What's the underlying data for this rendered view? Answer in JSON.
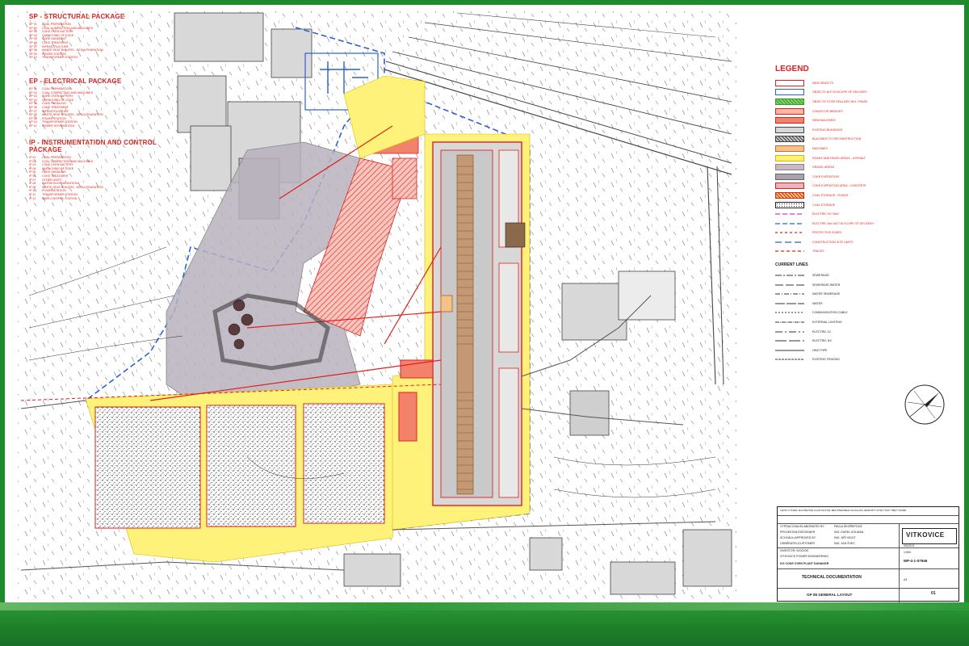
{
  "packages": [
    {
      "title": "SP - STRUCTURAL PACKAGE",
      "items": [
        {
          "code": "SP 01",
          "text": "COAL PREPARATION"
        },
        {
          "code": "SP 02",
          "text": "COAL COMPACTING AND MACHINES"
        },
        {
          "code": "SP 03",
          "text": "COKE OVEN BATTERY"
        },
        {
          "code": "SP 04",
          "text": "QUENCHING OF COKE"
        },
        {
          "code": "SP 05",
          "text": "COKE HANDLING"
        },
        {
          "code": "SP 06",
          "text": "COKE TREATMENT"
        },
        {
          "code": "SP 07",
          "text": "INFRASTRUCTURE"
        },
        {
          "code": "SP 08",
          "text": "WASTE HEAT BOILERS - DESULPHURATION"
        },
        {
          "code": "SP 09",
          "text": "POWER STATION"
        },
        {
          "code": "SP 10",
          "text": "TRANSFORMER STATION"
        }
      ]
    },
    {
      "title": "EP - ELECTRICAL PACKAGE",
      "items": [
        {
          "code": "EP 01",
          "text": "COAL PREPARATION"
        },
        {
          "code": "EP 02",
          "text": "COAL COMPACTING AND MACHINES"
        },
        {
          "code": "EP 03",
          "text": "COKE OVEN BATTERY"
        },
        {
          "code": "EP 04",
          "text": "QUENCHING OF COKE"
        },
        {
          "code": "EP 05",
          "text": "COKE HANDLING"
        },
        {
          "code": "EP 06",
          "text": "COKE TREATMENT"
        },
        {
          "code": "EP 07",
          "text": "INFRASTRUCTURE"
        },
        {
          "code": "EP 08",
          "text": "WASTE HEAT BOILERS - DESULPHURATION"
        },
        {
          "code": "EP 09",
          "text": "POWER STATION"
        },
        {
          "code": "EP 10",
          "text": "TRANSFORMER STATION"
        },
        {
          "code": "EP 11",
          "text": "POWER DISTRIBUTION"
        }
      ]
    },
    {
      "title": "IP - INSTRUMENTATION AND CONTROL PACKAGE",
      "items": [
        {
          "code": "IP 01",
          "text": "COAL PREPARATION"
        },
        {
          "code": "IP 02",
          "text": "COAL COMPACTING AND MACHINES"
        },
        {
          "code": "IP 03",
          "text": "COKE OVEN BATTERY"
        },
        {
          "code": "IP 04",
          "text": "QUENCHING OF COKE"
        },
        {
          "code": "IP 05",
          "text": "COKE HANDLING"
        },
        {
          "code": "IP 06",
          "text": "COKE TREATMENT"
        },
        {
          "code": "IP 07",
          "text": "OTHER UNITS"
        },
        {
          "code": "IP 08",
          "text": "GAS DESULPHURIZATION"
        },
        {
          "code": "IP 09",
          "text": "WASTE HEAT BOILERS - DESULPHURATION"
        },
        {
          "code": "IP 10",
          "text": "POWER STATION"
        },
        {
          "code": "IP 11",
          "text": "TRANSFORMER STATION"
        },
        {
          "code": "IP 12",
          "text": "MAIN CONTROL STATION"
        }
      ]
    }
  ],
  "legend": {
    "title": "LEGEND",
    "items": [
      {
        "label": "NEW OBJECTS",
        "fill": "#ffffff",
        "border": "#e0201c",
        "style": "solid"
      },
      {
        "label": "OBJECTS NOT IN SCOPE OF DELIVERY",
        "fill": "#ffffff",
        "border": "#2b5fd9",
        "style": "solid"
      },
      {
        "label": "OBJECTS TO BE REALIZED IN II. PHASE",
        "fill": "#7fd36b",
        "border": "#3a9a2a",
        "style": "hatch"
      },
      {
        "label": "CONVEYOR BRIDGES",
        "fill": "#f7b9a8",
        "border": "#e0201c",
        "style": "solid"
      },
      {
        "label": "NEW BUILDINGS",
        "fill": "#f2826a",
        "border": "#e0201c",
        "style": "solid"
      },
      {
        "label": "EXISTING BUILDINGS",
        "fill": "#d8d8d8",
        "border": "#444444",
        "style": "solid"
      },
      {
        "label": "BUILDINGS TO RECONSTRUCTION",
        "fill": "#c8c8c8",
        "border": "#444444",
        "style": "hatch"
      },
      {
        "label": "MACHINES",
        "fill": "#f3c38a",
        "border": "#c0702a",
        "style": "solid"
      },
      {
        "label": "ROADS AND PAVED AREAS - ASPHALT",
        "fill": "#fff27a",
        "border": "#d6b800",
        "style": "solid"
      },
      {
        "label": "GRAVEL AREAS",
        "fill": "#c9b8c2",
        "border": "#888888",
        "style": "solid"
      },
      {
        "label": "COKE EXPEDITION",
        "fill": "#a9a3ad",
        "border": "#666666",
        "style": "solid"
      },
      {
        "label": "COKE EXPEDITION AREA - CONCRETE",
        "fill": "#e5b8c0",
        "border": "#e0201c",
        "style": "solid"
      },
      {
        "label": "COAL STORAGE - ROADS",
        "fill": "#f3d06a",
        "border": "#e0201c",
        "style": "hatch"
      },
      {
        "label": "COAL STORAGE",
        "fill": "#ffffff",
        "border": "#222222",
        "style": "dots"
      }
    ],
    "lines": [
      {
        "label": "ELECTRIC HV 35kV",
        "color": "#c23fc8",
        "dash": "6,3"
      },
      {
        "label": "ELECTRIC 6kV NOT IN SCOPE OF DELIVERY",
        "color": "#2b5fd9",
        "dash": "6,3"
      },
      {
        "label": "PROTECTIVE ZONES",
        "color": "#e0201c",
        "dash": "3,3"
      },
      {
        "label": "CONSTRUCTION SITE LIMITS",
        "color": "#2b5fd9",
        "dash": "8,4"
      },
      {
        "label": "TRACKS",
        "color": "#e0201c",
        "dash": "4,3"
      }
    ]
  },
  "current_lines": {
    "title": "CURRENT LINES",
    "items": [
      {
        "label": "SEWERAGE",
        "dash": "8,2,2,2"
      },
      {
        "label": "SEWERAGE WATER",
        "dash": "10,3"
      },
      {
        "label": "WATER SEWERAGE",
        "dash": "6,2,1,2"
      },
      {
        "label": "WATER",
        "dash": "12,2"
      },
      {
        "label": "COMMUNICATION CABLE",
        "dash": "2,2"
      },
      {
        "label": "EXTERNAL LIGHTING",
        "dash": "5,1,1,1"
      },
      {
        "label": "ELECTRIC LV",
        "dash": "9,3,2,3"
      },
      {
        "label": "ELECTRIC HV",
        "dash": "14,3"
      },
      {
        "label": "HEAT PIPE",
        "dash": "none"
      },
      {
        "label": "EXISTING FENCING",
        "dash": "3,1"
      }
    ]
  },
  "title_block": {
    "header_note": "TENTO VÝKRES JE DUŠEVNÍM VLASTNICTVÍM, BEZ PÍSEMNÉHO SOUHLASU NESMÍ BÝT POSKYTNUT TŘETÍ OSOBĚ",
    "rows": [
      {
        "left": "VYPRACOVAL/ELABORATED BY",
        "right": "PAVLA ŠKOŘEPOVÁ"
      },
      {
        "left": "PROJEKTANT/DESIGNER",
        "right": "ING. KAREL KOLMAN"
      },
      {
        "left": "SCHVÁLIL/APPROVED BY",
        "right": "ING. JIŘÍ VIDOT"
      },
      {
        "left": "ODBĚRATEL/CUSTOMER",
        "right": "ING. JAN ŠVEC"
      }
    ],
    "customer": "INVESTOR: WOOGIE",
    "project": "KO COKE OVEN PLANT DANANGR",
    "company": "VITKOVICE POWER ENGINEERING",
    "doc_number": "MP-4-1-07946",
    "date": "05/2013",
    "scale": "1:500",
    "document_type": "TECHNICAL DOCUMENTATION",
    "drawing_title": "GP 08 GENERAL LAYOUT",
    "format": "A3",
    "revision": "01",
    "logo_text": "VITKOVICE"
  },
  "colors": {
    "frame": "#1f8a2c",
    "red": "#e0201c",
    "yellow": "#fff27a",
    "blue_dashed": "#2b5fd9",
    "gray_area": "#b7b2bd"
  }
}
